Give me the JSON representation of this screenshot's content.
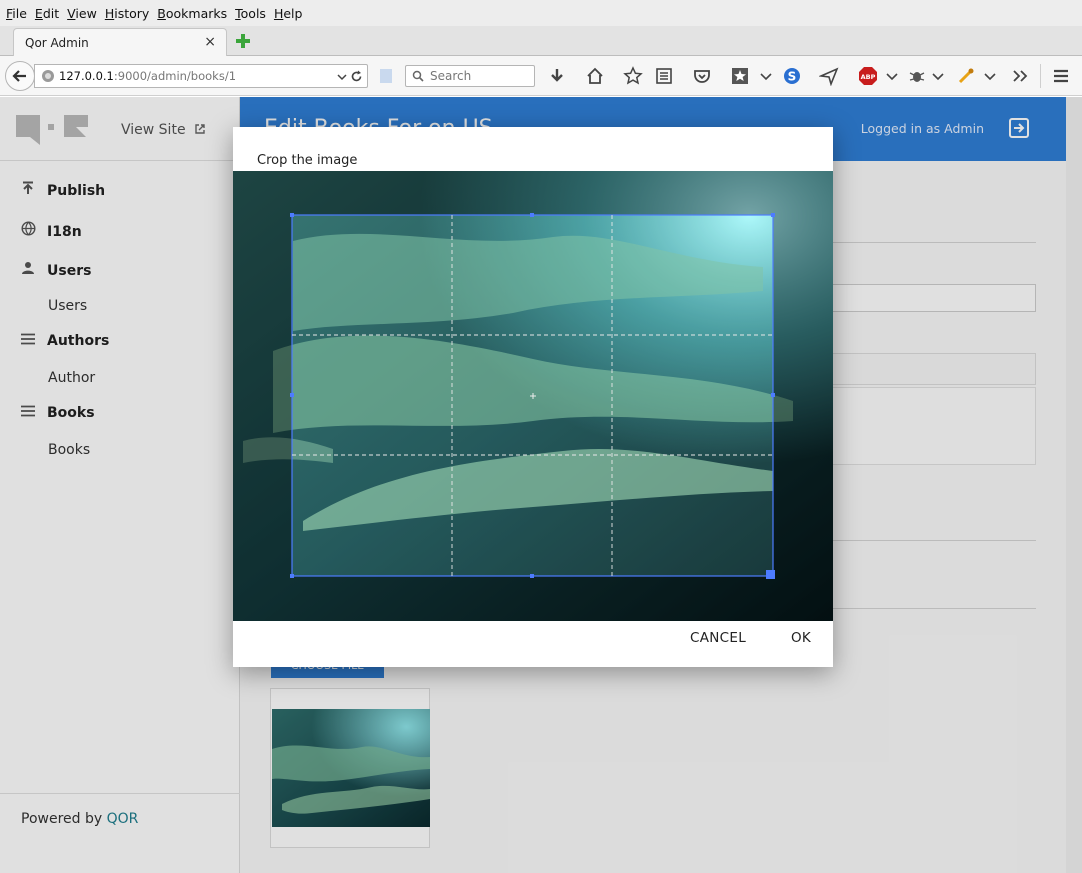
{
  "browser": {
    "menu": [
      "File",
      "Edit",
      "View",
      "History",
      "Bookmarks",
      "Tools",
      "Help"
    ],
    "tab_title": "Qor Admin",
    "tab_close": "×",
    "url_host": "127.0.0.1",
    "url_rest": ":9000/admin/books/1",
    "search_placeholder": "Search"
  },
  "sidebar": {
    "view_site": "View Site",
    "groups": [
      {
        "label": "Publish",
        "icon": "publish-icon"
      },
      {
        "label": "I18n",
        "icon": "globe-icon"
      },
      {
        "label": "Users",
        "icon": "person-icon",
        "items": [
          "Users"
        ]
      },
      {
        "label": "Authors",
        "icon": "menu-icon",
        "items": [
          "Author"
        ]
      },
      {
        "label": "Books",
        "icon": "menu-icon",
        "items": [
          "Books"
        ]
      }
    ],
    "powered_by": "Powered by",
    "powered_brand": "QOR"
  },
  "header": {
    "title": "Edit Books For on US",
    "logged_in": "Logged in as Admin"
  },
  "form": {
    "choose_file": "CHOOSE FILE"
  },
  "modal": {
    "title": "Crop the image",
    "cancel": "CANCEL",
    "ok": "OK"
  },
  "colors": {
    "accent": "#2f7fd6",
    "crop_border": "#4d7cff",
    "brand_link": "#1f7f8f"
  }
}
